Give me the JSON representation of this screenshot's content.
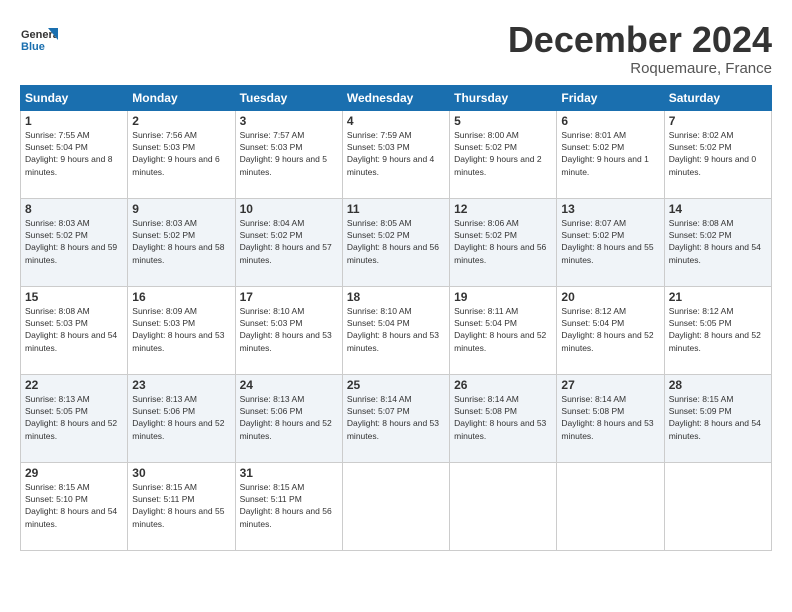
{
  "logo": {
    "line1": "General",
    "line2": "Blue"
  },
  "header": {
    "title": "December 2024",
    "location": "Roquemaure, France"
  },
  "weekdays": [
    "Sunday",
    "Monday",
    "Tuesday",
    "Wednesday",
    "Thursday",
    "Friday",
    "Saturday"
  ],
  "weeks": [
    [
      {
        "day": 1,
        "sunrise": "7:55 AM",
        "sunset": "5:04 PM",
        "daylight": "9 hours and 8 minutes."
      },
      {
        "day": 2,
        "sunrise": "7:56 AM",
        "sunset": "5:03 PM",
        "daylight": "9 hours and 6 minutes."
      },
      {
        "day": 3,
        "sunrise": "7:57 AM",
        "sunset": "5:03 PM",
        "daylight": "9 hours and 5 minutes."
      },
      {
        "day": 4,
        "sunrise": "7:59 AM",
        "sunset": "5:03 PM",
        "daylight": "9 hours and 4 minutes."
      },
      {
        "day": 5,
        "sunrise": "8:00 AM",
        "sunset": "5:02 PM",
        "daylight": "9 hours and 2 minutes."
      },
      {
        "day": 6,
        "sunrise": "8:01 AM",
        "sunset": "5:02 PM",
        "daylight": "9 hours and 1 minute."
      },
      {
        "day": 7,
        "sunrise": "8:02 AM",
        "sunset": "5:02 PM",
        "daylight": "9 hours and 0 minutes."
      }
    ],
    [
      {
        "day": 8,
        "sunrise": "8:03 AM",
        "sunset": "5:02 PM",
        "daylight": "8 hours and 59 minutes."
      },
      {
        "day": 9,
        "sunrise": "8:03 AM",
        "sunset": "5:02 PM",
        "daylight": "8 hours and 58 minutes."
      },
      {
        "day": 10,
        "sunrise": "8:04 AM",
        "sunset": "5:02 PM",
        "daylight": "8 hours and 57 minutes."
      },
      {
        "day": 11,
        "sunrise": "8:05 AM",
        "sunset": "5:02 PM",
        "daylight": "8 hours and 56 minutes."
      },
      {
        "day": 12,
        "sunrise": "8:06 AM",
        "sunset": "5:02 PM",
        "daylight": "8 hours and 56 minutes."
      },
      {
        "day": 13,
        "sunrise": "8:07 AM",
        "sunset": "5:02 PM",
        "daylight": "8 hours and 55 minutes."
      },
      {
        "day": 14,
        "sunrise": "8:08 AM",
        "sunset": "5:02 PM",
        "daylight": "8 hours and 54 minutes."
      }
    ],
    [
      {
        "day": 15,
        "sunrise": "8:08 AM",
        "sunset": "5:03 PM",
        "daylight": "8 hours and 54 minutes."
      },
      {
        "day": 16,
        "sunrise": "8:09 AM",
        "sunset": "5:03 PM",
        "daylight": "8 hours and 53 minutes."
      },
      {
        "day": 17,
        "sunrise": "8:10 AM",
        "sunset": "5:03 PM",
        "daylight": "8 hours and 53 minutes."
      },
      {
        "day": 18,
        "sunrise": "8:10 AM",
        "sunset": "5:04 PM",
        "daylight": "8 hours and 53 minutes."
      },
      {
        "day": 19,
        "sunrise": "8:11 AM",
        "sunset": "5:04 PM",
        "daylight": "8 hours and 52 minutes."
      },
      {
        "day": 20,
        "sunrise": "8:12 AM",
        "sunset": "5:04 PM",
        "daylight": "8 hours and 52 minutes."
      },
      {
        "day": 21,
        "sunrise": "8:12 AM",
        "sunset": "5:05 PM",
        "daylight": "8 hours and 52 minutes."
      }
    ],
    [
      {
        "day": 22,
        "sunrise": "8:13 AM",
        "sunset": "5:05 PM",
        "daylight": "8 hours and 52 minutes."
      },
      {
        "day": 23,
        "sunrise": "8:13 AM",
        "sunset": "5:06 PM",
        "daylight": "8 hours and 52 minutes."
      },
      {
        "day": 24,
        "sunrise": "8:13 AM",
        "sunset": "5:06 PM",
        "daylight": "8 hours and 52 minutes."
      },
      {
        "day": 25,
        "sunrise": "8:14 AM",
        "sunset": "5:07 PM",
        "daylight": "8 hours and 53 minutes."
      },
      {
        "day": 26,
        "sunrise": "8:14 AM",
        "sunset": "5:08 PM",
        "daylight": "8 hours and 53 minutes."
      },
      {
        "day": 27,
        "sunrise": "8:14 AM",
        "sunset": "5:08 PM",
        "daylight": "8 hours and 53 minutes."
      },
      {
        "day": 28,
        "sunrise": "8:15 AM",
        "sunset": "5:09 PM",
        "daylight": "8 hours and 54 minutes."
      }
    ],
    [
      {
        "day": 29,
        "sunrise": "8:15 AM",
        "sunset": "5:10 PM",
        "daylight": "8 hours and 54 minutes."
      },
      {
        "day": 30,
        "sunrise": "8:15 AM",
        "sunset": "5:11 PM",
        "daylight": "8 hours and 55 minutes."
      },
      {
        "day": 31,
        "sunrise": "8:15 AM",
        "sunset": "5:11 PM",
        "daylight": "8 hours and 56 minutes."
      },
      null,
      null,
      null,
      null
    ]
  ]
}
